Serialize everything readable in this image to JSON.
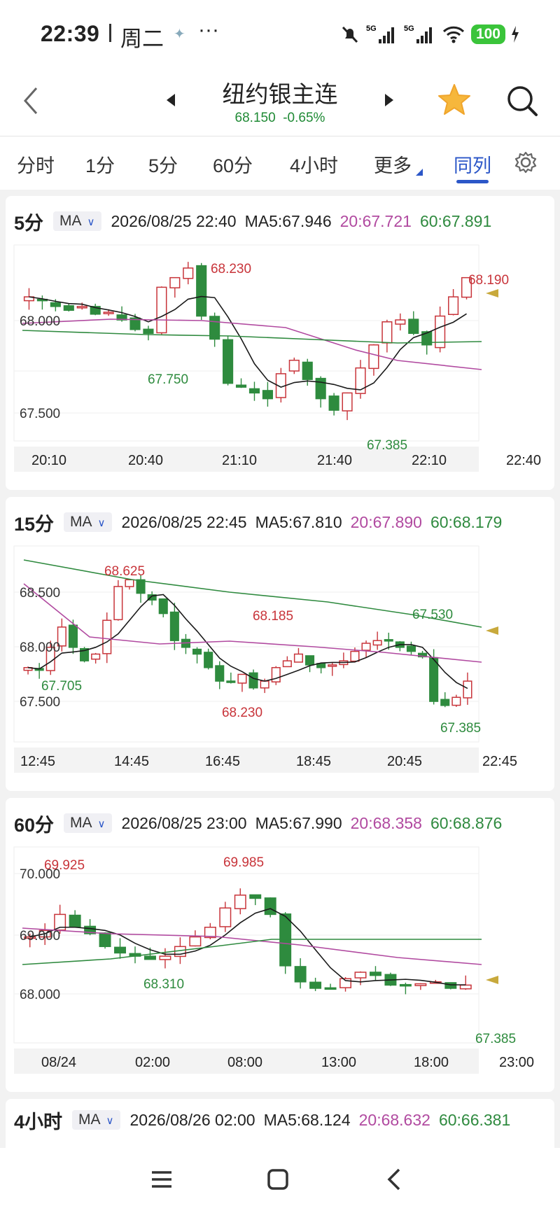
{
  "status": {
    "time": "22:39",
    "day": "周二",
    "battery": "100"
  },
  "header": {
    "title": "纽约银主连",
    "price": "68.150",
    "change": "-0.65%"
  },
  "tabs": [
    {
      "label": "分时"
    },
    {
      "label": "1分"
    },
    {
      "label": "5分"
    },
    {
      "label": "60分"
    },
    {
      "label": "4小时"
    },
    {
      "label": "更多"
    },
    {
      "label": "同列"
    }
  ],
  "colors": {
    "up": "#c8343a",
    "down": "#2e8b3e",
    "ma5": "#1a1a1a",
    "ma20": "#b14aa0",
    "ma60": "#2f8a3f",
    "accent": "#2c57c8"
  },
  "panels": [
    {
      "period": "5分",
      "ma_label": "MA",
      "datetime": "2026/08/25 22:40",
      "ma5": "MA5:67.946",
      "ma20": "20:67.721",
      "ma60": "60:67.891",
      "chart_data": {
        "type": "candlestick",
        "y_ticks": [
          "68.000",
          "67.500"
        ],
        "x_labels": [
          "20:10",
          "20:40",
          "21:10",
          "21:40",
          "22:10",
          "22:40"
        ],
        "annotations": [
          {
            "text": "68.230",
            "kind": "high"
          },
          {
            "text": "67.750",
            "kind": "low"
          },
          {
            "text": "67.385",
            "kind": "low"
          },
          {
            "text": "68.190",
            "kind": "last"
          }
        ]
      }
    },
    {
      "period": "15分",
      "ma_label": "MA",
      "datetime": "2026/08/25 22:45",
      "ma5": "MA5:67.810",
      "ma20": "20:67.890",
      "ma60": "60:68.179",
      "chart_data": {
        "type": "candlestick",
        "y_ticks": [
          "68.500",
          "68.000",
          "67.500"
        ],
        "x_labels": [
          "12:45",
          "14:45",
          "16:45",
          "18:45",
          "20:45",
          "22:45"
        ],
        "annotations": [
          {
            "text": "68.625",
            "kind": "high"
          },
          {
            "text": "68.185",
            "kind": "high"
          },
          {
            "text": "68.230",
            "kind": "high"
          },
          {
            "text": "67.705",
            "kind": "low"
          },
          {
            "text": "67.530",
            "kind": "low"
          },
          {
            "text": "67.385",
            "kind": "low"
          }
        ]
      }
    },
    {
      "period": "60分",
      "ma_label": "MA",
      "datetime": "2026/08/25 23:00",
      "ma5": "MA5:67.990",
      "ma20": "20:68.358",
      "ma60": "60:68.876",
      "chart_data": {
        "type": "candlestick",
        "y_ticks": [
          "70.000",
          "69.000",
          "68.000"
        ],
        "x_labels": [
          "08/24",
          "02:00",
          "08:00",
          "13:00",
          "18:00",
          "23:00"
        ],
        "annotations": [
          {
            "text": "69.925",
            "kind": "high"
          },
          {
            "text": "69.985",
            "kind": "high"
          },
          {
            "text": "68.310",
            "kind": "low"
          },
          {
            "text": "67.385",
            "kind": "low"
          }
        ]
      }
    },
    {
      "period": "4小时",
      "ma_label": "MA",
      "datetime": "2026/08/26 02:00",
      "ma5": "MA5:68.124",
      "ma20": "20:68.632",
      "ma60": "60:66.381"
    }
  ],
  "nav": [
    "menu-icon",
    "home-icon",
    "back-icon"
  ]
}
